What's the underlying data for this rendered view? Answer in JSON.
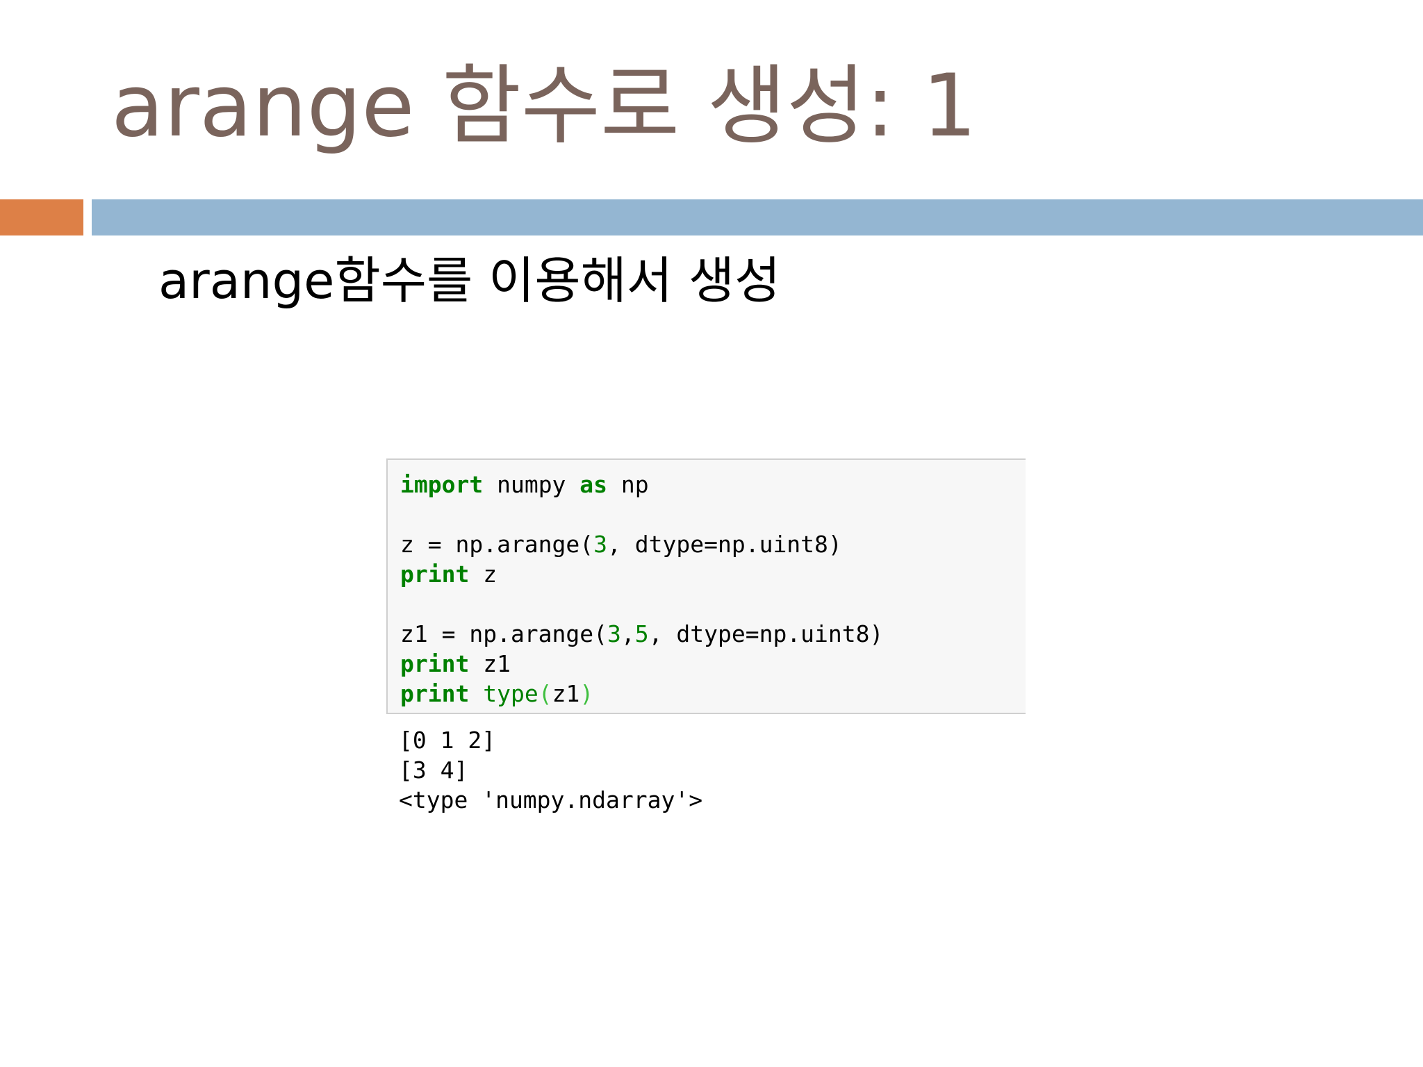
{
  "slide": {
    "title": "arange 함수로 생성: 1",
    "bullet": "arange함수를 이용해서 생성",
    "colors": {
      "title": "#7a645c",
      "accent_bar": "#dd8047",
      "main_bar": "#94b6d2",
      "keyword": "#008000"
    }
  },
  "code": {
    "line1": {
      "kw1": "import",
      "t1": " numpy ",
      "kw2": "as",
      "t2": " np"
    },
    "line3": {
      "t1": "z = np.arange(",
      "n1": "3",
      "t2": ", dtype=np.uint8)"
    },
    "line4": {
      "kw": "print",
      "t": " z"
    },
    "line6": {
      "t1": "z1 = np.arange(",
      "n1": "3",
      "t2": ",",
      "n2": "5",
      "t3": ", dtype=np.uint8)"
    },
    "line7": {
      "kw": "print",
      "t": " z1"
    },
    "line8": {
      "kw": "print",
      "t1": " ",
      "bi": "type",
      "p1": "(",
      "t2": "z1",
      "p2": ")"
    }
  },
  "output": {
    "lines": [
      "[0 1 2]",
      "[3 4]",
      "<type 'numpy.ndarray'>"
    ]
  }
}
